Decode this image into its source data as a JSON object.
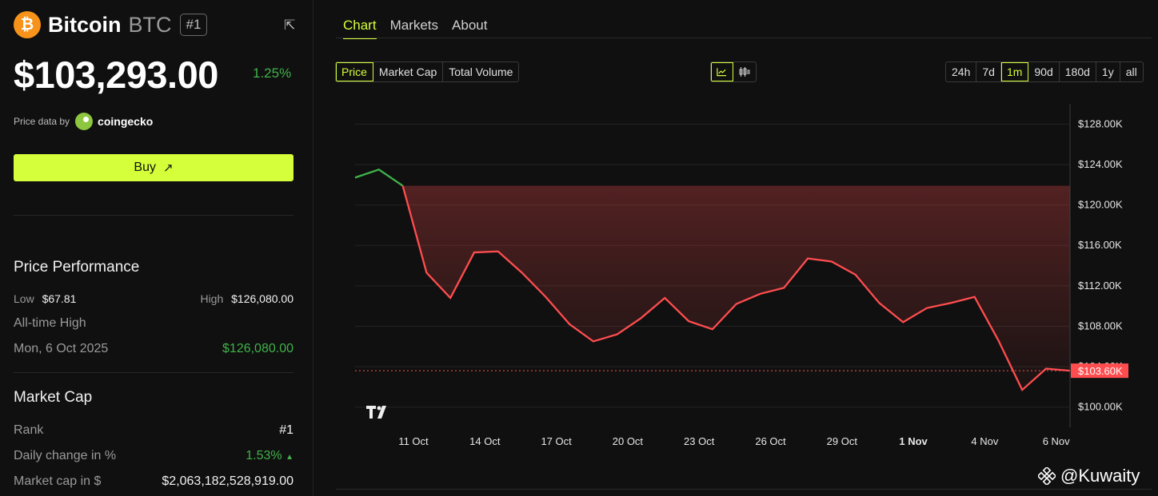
{
  "coin": {
    "name": "Bitcoin",
    "symbol": "BTC",
    "rank_badge": "#1",
    "price": "$103,293.00",
    "price_change": "1.25%",
    "price_data_label": "Price data by",
    "provider": "coingecko",
    "buy_label": "Buy",
    "buy_icon": "arrow-up-right-icon"
  },
  "performance": {
    "title": "Price Performance",
    "low_label": "Low",
    "low_value": "$67.81",
    "high_label": "High",
    "high_value": "$126,080.00",
    "ath_label": "All-time High",
    "ath_date": "Mon, 6 Oct 2025",
    "ath_value": "$126,080.00"
  },
  "market_cap": {
    "title": "Market Cap",
    "rank_label": "Rank",
    "rank_value": "#1",
    "daily_label": "Daily change in %",
    "daily_value": "1.53%",
    "mcap_label": "Market cap in $",
    "mcap_value": "$2,063,182,528,919.00"
  },
  "tabs": [
    "Chart",
    "Markets",
    "About"
  ],
  "metric_buttons": [
    "Price",
    "Market Cap",
    "Total Volume"
  ],
  "range_buttons": [
    "24h",
    "7d",
    "1m",
    "90d",
    "180d",
    "1y",
    "all"
  ],
  "active_range": "1m",
  "watermark": "@Kuwaity",
  "colors": {
    "accent": "#d4ff3a",
    "up": "#3fb24a",
    "down": "#ff4d4f"
  },
  "chart_data": {
    "type": "line",
    "x": [
      "8 Oct",
      "9 Oct",
      "10 Oct",
      "11 Oct",
      "12 Oct",
      "13 Oct",
      "14 Oct",
      "15 Oct",
      "16 Oct",
      "17 Oct",
      "18 Oct",
      "19 Oct",
      "20 Oct",
      "21 Oct",
      "22 Oct",
      "23 Oct",
      "24 Oct",
      "25 Oct",
      "26 Oct",
      "27 Oct",
      "28 Oct",
      "29 Oct",
      "30 Oct",
      "31 Oct",
      "1 Nov",
      "2 Nov",
      "3 Nov",
      "4 Nov",
      "5 Nov",
      "6 Nov",
      "7 Nov"
    ],
    "y": [
      122700,
      123500,
      121900,
      113300,
      110800,
      115300,
      115400,
      113300,
      110900,
      108200,
      106500,
      107200,
      108800,
      110800,
      108500,
      107700,
      110200,
      111200,
      111800,
      114700,
      114400,
      113100,
      110300,
      108400,
      109800,
      110300,
      110900,
      106600,
      101700,
      103800,
      103600
    ],
    "x_ticks": [
      "11 Oct",
      "14 Oct",
      "17 Oct",
      "20 Oct",
      "23 Oct",
      "26 Oct",
      "29 Oct",
      "1 Nov",
      "4 Nov",
      "6 Nov"
    ],
    "y_ticks": [
      "$100.00K",
      "$104.00K",
      "$108.00K",
      "$112.00K",
      "$116.00K",
      "$120.00K",
      "$124.00K",
      "$128.00K"
    ],
    "ylim": [
      98000,
      130000
    ],
    "current_label": "$103.60K",
    "current_value": 103600,
    "grid": true
  }
}
